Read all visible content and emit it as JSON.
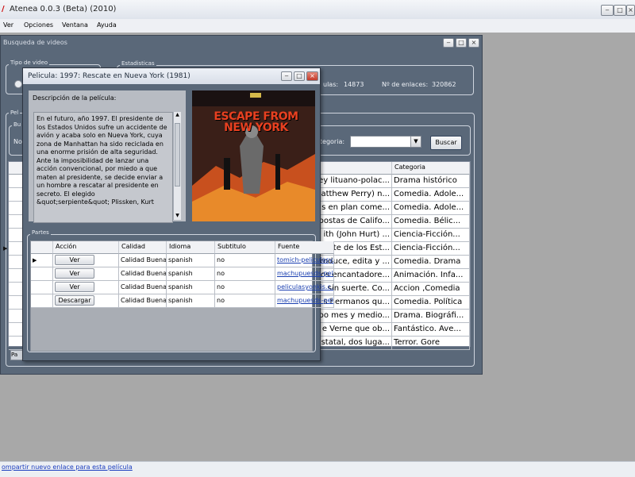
{
  "app": {
    "title": "Atenea 0.0.3 (Beta) (2010)",
    "icon": "atenea-icon"
  },
  "menu": [
    "Ver",
    "Opciones",
    "Ventana",
    "Ayuda"
  ],
  "search_window": {
    "title": "Busqueda de videos",
    "tipo_video_label": "Tipo de video",
    "estadisticas_label": "Estadisticas",
    "peliculas_label_fragment": "ulas:",
    "peliculas_count": "14873",
    "enlaces_label": "Nº de enlaces:",
    "enlaces_count": "320862",
    "peliculas_group_fragment": "Pel",
    "busqueda_group_fragment": "Bu",
    "nombre_fragment": "No",
    "categoria_label": "ategoria:",
    "buscar_label": "Buscar",
    "pager_fragment": "Pa",
    "grid": {
      "category_header": "Categoria",
      "rows": [
        {
          "desc": "ey lituano-polac...",
          "cat": "Drama histórico"
        },
        {
          "desc": "atthew Perry) n...",
          "cat": "Comedia. Adole..."
        },
        {
          "desc": "s en plan come...",
          "cat": "Comedia. Adole..."
        },
        {
          "desc": "postas de Califo...",
          "cat": "Comedia. Bélic..."
        },
        {
          "desc": "ith (John Hurt) ...",
          "cat": "Ciencia-Ficción..."
        },
        {
          "desc": "ente de los Est...",
          "cat": "Ciencia-Ficción..."
        },
        {
          "desc": "roduce, edita y ...",
          "cat": "Comedia. Drama"
        },
        {
          "desc": "os encantadore...",
          "cat": "Animación. Infa..."
        },
        {
          "desc": "sin suerte. Co...",
          "cat": "Accion ,Comedia"
        },
        {
          "desc": "s hermanos qu...",
          "cat": "Comedia. Política"
        },
        {
          "desc": "po mes y medio...",
          "cat": "Drama. Biográfi..."
        },
        {
          "desc": "e Verne que ob...",
          "cat": "Fantástico. Ave..."
        },
        {
          "desc": "statal, dos luga...",
          "cat": "Terror. Gore"
        }
      ]
    }
  },
  "movie_dialog": {
    "title": "Pelicula: 1997: Rescate en Nueva York (1981)",
    "desc_label": "Descripción de la película:",
    "description": "En el futuro, año 1997. El presidente de los Estados Unidos sufre un accidente de avión y acaba solo en Nueva York, cuya zona de Manhattan ha sido reciclada en una enorme prisión de alta seguridad. Ante la imposibilidad de lanzar una acción convencional, por miedo a que maten al presidente, se decide enviar a un hombre a rescatar al presidente en secreto. El elegido &quot;serpiente&quot; Plissken, Kurt",
    "poster_title": "ESCAPE FROM NEW YORK",
    "partes_label": "Partes",
    "columns": [
      "Acción",
      "Calidad",
      "Idioma",
      "Subtitulo",
      "Fuente"
    ],
    "rows": [
      {
        "action": "Ver",
        "calidad": "Calidad Buena",
        "idioma": "spanish",
        "subtitulo": "no",
        "fuente": "tomich-peliculasy..."
      },
      {
        "action": "Ver",
        "calidad": "Calidad Buena",
        "idioma": "spanish",
        "subtitulo": "no",
        "fuente": "machupuesds-pel..."
      },
      {
        "action": "Ver",
        "calidad": "Calidad Buena",
        "idioma": "spanish",
        "subtitulo": "no",
        "fuente": "peliculasyonkis.c..."
      },
      {
        "action": "Descargar",
        "calidad": "Calidad Buena",
        "idioma": "spanish",
        "subtitulo": "no",
        "fuente": "machupuesds-pel..."
      }
    ]
  },
  "footer_link": "ompartir nuevo enlace para esta película"
}
